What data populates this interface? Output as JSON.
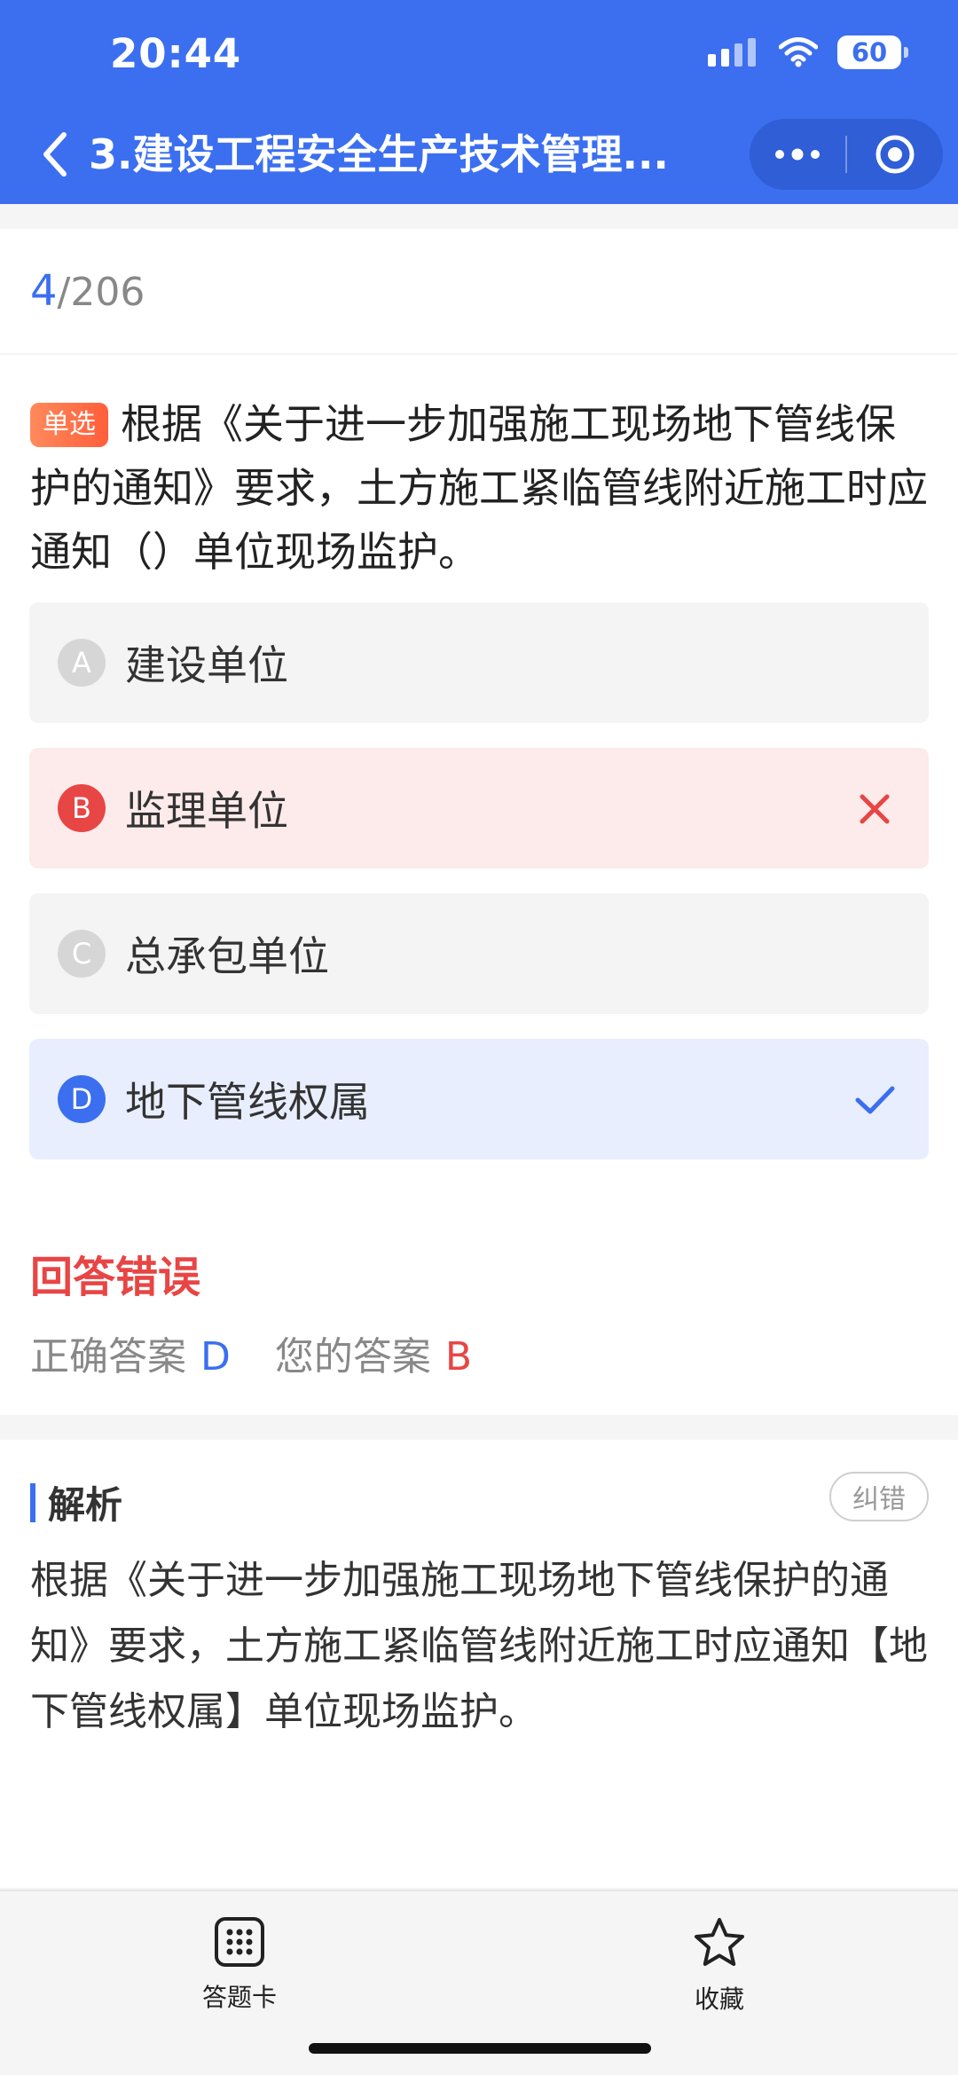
{
  "status_bar": {
    "time": "20:44",
    "battery": "60"
  },
  "nav": {
    "title": "3.建设工程安全生产技术管理...",
    "back_icon": "chevron-left-icon",
    "more_icon": "more-dots-icon",
    "close_icon": "target-circle-icon"
  },
  "progress": {
    "current": "4",
    "total": "/206"
  },
  "question": {
    "type_tag": "单选",
    "text": "根据《关于进一步加强施工现场地下管线保护的通知》要求，土方施工紧临管线附近施工时应通知（）单位现场监护。",
    "options": [
      {
        "letter": "A",
        "text": "建设单位",
        "state": "normal"
      },
      {
        "letter": "B",
        "text": "监理单位",
        "state": "wrong"
      },
      {
        "letter": "C",
        "text": "总承包单位",
        "state": "normal"
      },
      {
        "letter": "D",
        "text": "地下管线权属",
        "state": "correct"
      }
    ]
  },
  "result": {
    "status": "回答错误",
    "correct_label": "正确答案",
    "correct_value": "D",
    "user_label": "您的答案",
    "user_value": "B"
  },
  "explanation": {
    "title": "解析",
    "report_button": "纠错",
    "text": "根据《关于进一步加强施工现场地下管线保护的通知》要求，土方施工紧临管线附近施工时应通知【地下管线权属】单位现场监护。"
  },
  "bottom_bar": {
    "answer_card_label": "答题卡",
    "favorite_label": "收藏"
  },
  "colors": {
    "primary": "#3b6ff0",
    "wrong": "#e84545",
    "tag": "#ff6b45"
  }
}
